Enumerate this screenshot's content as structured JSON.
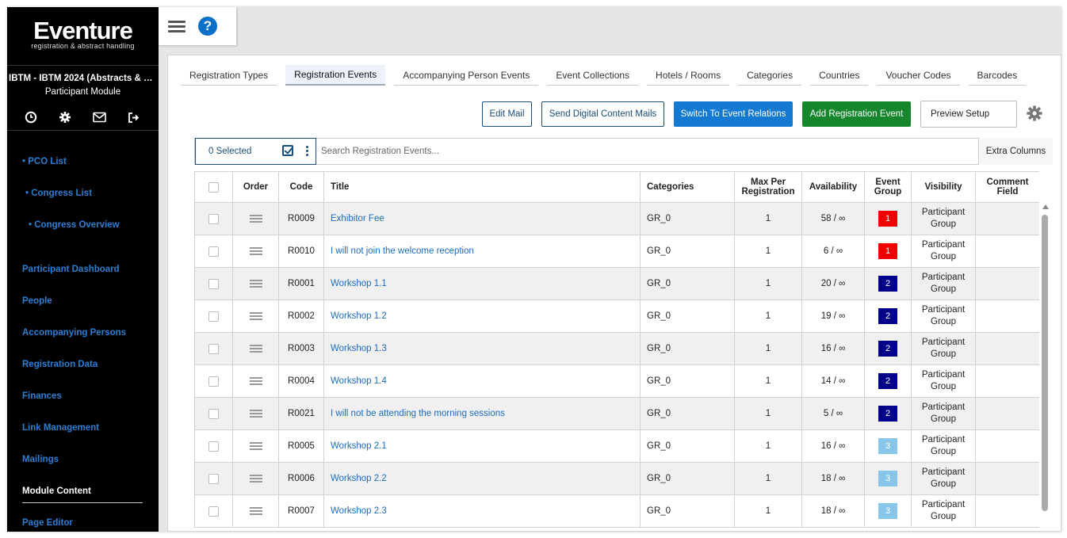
{
  "app": {
    "logo_title": "Eventure",
    "logo_subtitle": "registration & abstract handling",
    "event_name": "IBTM - IBTM 2024 (Abstracts & Par...",
    "module_name": "Participant Module"
  },
  "sidebar": {
    "icons": [
      "clock-icon",
      "gear-icon",
      "mail-icon",
      "logout-icon"
    ],
    "links": {
      "pco_list": "• PCO List",
      "congress_list": "• Congress List",
      "congress_overview": "• Congress Overview",
      "participant_dashboard": "Participant Dashboard",
      "people": "People",
      "accompanying_persons": "Accompanying Persons",
      "registration_data": "Registration Data",
      "finances": "Finances",
      "link_management": "Link Management",
      "mailings": "Mailings",
      "module_content": "Module Content",
      "page_editor": "Page Editor"
    }
  },
  "topbar": {
    "help_label": "?"
  },
  "tabs": [
    {
      "label": "Registration Types"
    },
    {
      "label": "Registration Events"
    },
    {
      "label": "Accompanying Person Events"
    },
    {
      "label": "Event Collections"
    },
    {
      "label": "Hotels / Rooms"
    },
    {
      "label": "Categories"
    },
    {
      "label": "Countries"
    },
    {
      "label": "Voucher Codes"
    },
    {
      "label": "Barcodes"
    }
  ],
  "actions": {
    "edit_mail": "Edit Mail",
    "send_digital": "Send Digital Content Mails",
    "switch_relations": "Switch To Event Relations",
    "add_event": "Add Registration Event",
    "preview_setup": "Preview Setup"
  },
  "toolbar": {
    "selected": "0 Selected",
    "search_placeholder": "Search Registration Events...",
    "extra_columns": "Extra Columns"
  },
  "table": {
    "headers": {
      "order": "Order",
      "code": "Code",
      "title": "Title",
      "categories": "Categories",
      "max_line1": "Max Per",
      "max_line2": "Registration",
      "availability": "Availability",
      "group_line1": "Event",
      "group_line2": "Group",
      "visibility": "Visibility",
      "comment_line1": "Comment",
      "comment_line2": "Field"
    },
    "rows": [
      {
        "code": "R0009",
        "title": "Exhibitor Fee",
        "category": "GR_0",
        "max": "1",
        "availability": "58 / ∞",
        "group": "1",
        "vis1": "Participant",
        "vis2": "Group"
      },
      {
        "code": "R0010",
        "title": "I will not join the welcome reception",
        "category": "GR_0",
        "max": "1",
        "availability": "6 / ∞",
        "group": "1",
        "vis1": "Participant",
        "vis2": "Group"
      },
      {
        "code": "R0001",
        "title": "Workshop 1.1",
        "category": "GR_0",
        "max": "1",
        "availability": "20 / ∞",
        "group": "2",
        "vis1": "Participant",
        "vis2": "Group"
      },
      {
        "code": "R0002",
        "title": "Workshop 1.2",
        "category": "GR_0",
        "max": "1",
        "availability": "19 / ∞",
        "group": "2",
        "vis1": "Participant",
        "vis2": "Group"
      },
      {
        "code": "R0003",
        "title": "Workshop 1.3",
        "category": "GR_0",
        "max": "1",
        "availability": "16 / ∞",
        "group": "2",
        "vis1": "Participant",
        "vis2": "Group"
      },
      {
        "code": "R0004",
        "title": "Workshop 1.4",
        "category": "GR_0",
        "max": "1",
        "availability": "14 / ∞",
        "group": "2",
        "vis1": "Participant",
        "vis2": "Group"
      },
      {
        "code": "R0021",
        "title": "I will not be attending the morning sessions",
        "category": "GR_0",
        "max": "1",
        "availability": "5 / ∞",
        "group": "2",
        "vis1": "Participant",
        "vis2": "Group"
      },
      {
        "code": "R0005",
        "title": "Workshop 2.1",
        "category": "GR_0",
        "max": "1",
        "availability": "16 / ∞",
        "group": "3",
        "vis1": "Participant",
        "vis2": "Group"
      },
      {
        "code": "R0006",
        "title": "Workshop 2.2",
        "category": "GR_0",
        "max": "1",
        "availability": "18 / ∞",
        "group": "3",
        "vis1": "Participant",
        "vis2": "Group"
      },
      {
        "code": "R0007",
        "title": "Workshop 2.3",
        "category": "GR_0",
        "max": "1",
        "availability": "18 / ∞",
        "group": "3",
        "vis1": "Participant",
        "vis2": "Group"
      }
    ]
  },
  "group_colors": {
    "1": "#f00000",
    "2": "#00008b",
    "3": "#87c6e8"
  }
}
